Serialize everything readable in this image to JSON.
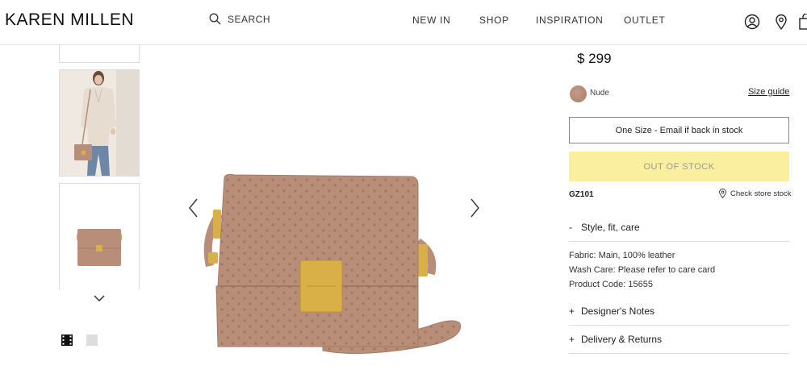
{
  "header": {
    "logo": "KAREN MILLEN",
    "search_label": "SEARCH",
    "nav": [
      "NEW IN",
      "SHOP",
      "INSPIRATION",
      "OUTLET"
    ],
    "icons": [
      "account-icon",
      "store-locator-icon",
      "shopping-bag-icon"
    ]
  },
  "product": {
    "price": "$ 299",
    "color_name": "Nude",
    "color_hex": "#b38a76",
    "size_guide": "Size guide",
    "size_option": "One Size - Email if back in stock",
    "stock_button": "OUT OF STOCK",
    "sku": "GZ101",
    "check_store": "Check store stock"
  },
  "accordion": {
    "style": {
      "sign": "-",
      "label": "Style, fit, care"
    },
    "details": [
      "Fabric: Main, 100% leather",
      "Wash Care: Please refer to care card",
      "Product Code: 15655"
    ],
    "designer": {
      "sign": "+",
      "label": "Designer's Notes"
    },
    "delivery": {
      "sign": "+",
      "label": "Delivery & Returns"
    }
  },
  "colors": {
    "oos_bg": "#f9ef9f",
    "leather": "#b88e79",
    "hardware": "#d9b048"
  }
}
